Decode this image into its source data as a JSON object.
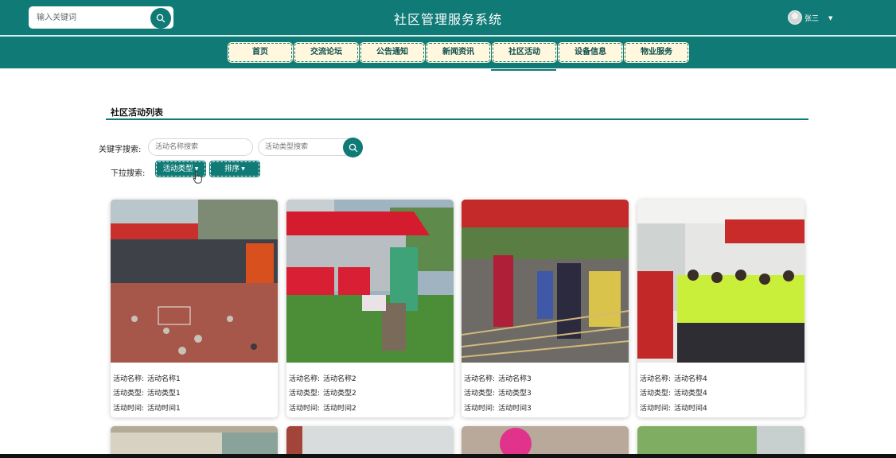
{
  "header": {
    "search_placeholder": "输入关键词",
    "title": "社区管理服务系统",
    "user_name": "张三",
    "accent": "#0f7a76"
  },
  "nav": {
    "items": [
      {
        "label": "首页"
      },
      {
        "label": "交流论坛"
      },
      {
        "label": "公告通知"
      },
      {
        "label": "新闻资讯"
      },
      {
        "label": "社区活动",
        "active": true
      },
      {
        "label": "设备信息"
      },
      {
        "label": "物业服务"
      }
    ]
  },
  "section": {
    "title": "社区活动列表",
    "keyword_label": "关键字搜索:",
    "name_placeholder": "活动名称搜索",
    "type_placeholder": "活动类型搜索",
    "dropdown_label": "下拉搜索:",
    "type_dropdown": "活动类型",
    "sort_dropdown": "排序"
  },
  "cards": [
    {
      "name_label": "活动名称:",
      "name": "活动名称1",
      "type_label": "活动类型:",
      "type": "活动类型1",
      "time_label": "活动时间:",
      "time": "活动时间1",
      "photo": "street-activity-photo"
    },
    {
      "name_label": "活动名称:",
      "name": "活动名称2",
      "type_label": "活动类型:",
      "type": "活动类型2",
      "time_label": "活动时间:",
      "time": "活动时间2",
      "photo": "tent-game-photo"
    },
    {
      "name_label": "活动名称:",
      "name": "活动名称3",
      "type_label": "活动类型:",
      "type": "活动类型3",
      "time_label": "活动时间:",
      "time": "活动时间3",
      "photo": "bamboo-dance-photo"
    },
    {
      "name_label": "活动名称:",
      "name": "活动名称4",
      "type_label": "活动类型:",
      "type": "活动类型4",
      "time_label": "活动时间:",
      "time": "活动时间4",
      "photo": "children-class-photo"
    }
  ]
}
